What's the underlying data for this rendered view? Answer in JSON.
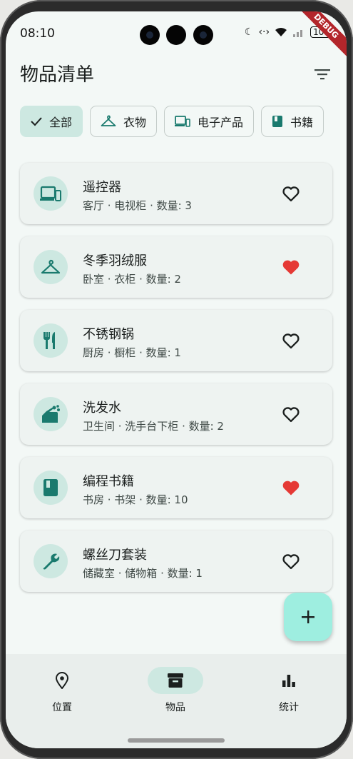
{
  "status_bar": {
    "time": "08:10",
    "battery": "100"
  },
  "debug_banner": "DEBUG",
  "appbar": {
    "title": "物品清单"
  },
  "filters": [
    {
      "label": "全部",
      "icon": "check-icon",
      "selected": true
    },
    {
      "label": "衣物",
      "icon": "hanger-icon",
      "selected": false
    },
    {
      "label": "电子产品",
      "icon": "devices-icon",
      "selected": false
    },
    {
      "label": "书籍",
      "icon": "book-icon",
      "selected": false
    }
  ],
  "items": [
    {
      "name": "遥控器",
      "sub": "客厅 · 电视柜 · 数量: 3",
      "icon": "devices-icon",
      "favorite": false
    },
    {
      "name": "冬季羽绒服",
      "sub": "卧室 · 衣柜 · 数量: 2",
      "icon": "hanger-icon",
      "favorite": true
    },
    {
      "name": "不锈钢锅",
      "sub": "厨房 · 橱柜 · 数量: 1",
      "icon": "restaurant-icon",
      "favorite": false
    },
    {
      "name": "洗发水",
      "sub": "卫生间 · 洗手台下柜 · 数量: 2",
      "icon": "soap-icon",
      "favorite": false
    },
    {
      "name": "编程书籍",
      "sub": "书房 · 书架 · 数量: 10",
      "icon": "book-icon",
      "favorite": true
    },
    {
      "name": "螺丝刀套装",
      "sub": "储藏室 · 储物箱 · 数量: 1",
      "icon": "wrench-icon",
      "favorite": false
    }
  ],
  "bottom_nav": [
    {
      "label": "位置",
      "icon": "location-icon",
      "active": false
    },
    {
      "label": "物品",
      "icon": "inventory-icon",
      "active": true
    },
    {
      "label": "统计",
      "icon": "bar-chart-icon",
      "active": false
    }
  ],
  "colors": {
    "accent": "#1a7a6e",
    "favorite": "#e53935",
    "fab": "#9eeee0"
  }
}
